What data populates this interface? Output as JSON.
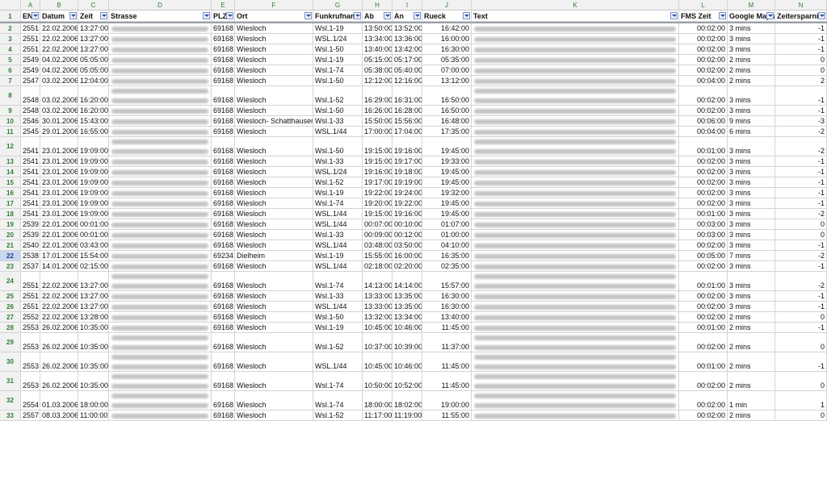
{
  "columns": [
    "A",
    "B",
    "C",
    "D",
    "E",
    "F",
    "G",
    "H",
    "I",
    "J",
    "K",
    "L",
    "M",
    "N"
  ],
  "headers": [
    "ENr",
    "Datum",
    "Zeit",
    "Strasse",
    "PLZ",
    "Ort",
    "Funkrufname",
    "Ab",
    "An",
    "Rueck",
    "Text",
    "FMS Zeit",
    "Google Maps",
    "Zeitersparnis"
  ],
  "header_row_number": "1",
  "rows": [
    {
      "n": "2",
      "v": [
        "2551",
        "22.02.2006",
        "13:27:00",
        "",
        "69168",
        "Wiesloch",
        "Wsl.1-19",
        "13:50:00",
        "13:52:00",
        "16:42:00",
        "",
        "00:02:00",
        "3 mins",
        "-1"
      ]
    },
    {
      "n": "3",
      "v": [
        "2551",
        "22.02.2006",
        "13:27:00",
        "",
        "69168",
        "Wiesloch",
        "WSL.1/24",
        "13:34:00",
        "13:36:00",
        "16:00:00",
        "",
        "00:02:00",
        "3 mins",
        "-1"
      ]
    },
    {
      "n": "4",
      "v": [
        "2551",
        "22.02.2006",
        "13:27:00",
        "",
        "69168",
        "Wiesloch",
        "Wsl.1-50",
        "13:40:00",
        "13:42:00",
        "16:30:00",
        "",
        "00:02:00",
        "3 mins",
        "-1"
      ]
    },
    {
      "n": "5",
      "v": [
        "2549",
        "04.02.2006",
        "05:05:00",
        "",
        "69168",
        "Wiesloch",
        "Wsl.1-19",
        "05:15:00",
        "05:17:00",
        "05:35:00",
        "",
        "00:02:00",
        "2 mins",
        "0"
      ]
    },
    {
      "n": "6",
      "v": [
        "2549",
        "04.02.2006",
        "05:05:00",
        "",
        "69168",
        "Wiesloch",
        "Wsl.1-74",
        "05:38:00",
        "05:40:00",
        "07:00:00",
        "",
        "00:02:00",
        "2 mins",
        "0"
      ]
    },
    {
      "n": "7",
      "v": [
        "2547",
        "03.02.2006",
        "12:04:00",
        "",
        "69168",
        "Wiesloch",
        "Wsl.1-50",
        "12:12:00",
        "12:16:00",
        "13:12:00",
        "",
        "00:04:00",
        "2 mins",
        "2"
      ]
    },
    {
      "n": "8",
      "v": [
        "2548",
        "03.02.2006",
        "16:20:00",
        "",
        "69168",
        "Wiesloch",
        "Wsl.1-52",
        "16:29:00",
        "16:31:00",
        "16:50:00",
        "",
        "00:02:00",
        "3 mins",
        "-1"
      ]
    },
    {
      "n": "9",
      "v": [
        "2548",
        "03.02.2006",
        "16:20:00",
        "",
        "69168",
        "Wiesloch",
        "Wsl.1-50",
        "16:26:00",
        "16:28:00",
        "16:50:00",
        "",
        "00:02:00",
        "3 mins",
        "-1"
      ]
    },
    {
      "n": "10",
      "v": [
        "2546",
        "30.01.2006",
        "15:43:00",
        "",
        "69168",
        "Wiesloch- Schatthausen",
        "Wsl.1-33",
        "15:50:00",
        "15:56:00",
        "16:48:00",
        "",
        "00:06:00",
        "9 mins",
        "-3"
      ]
    },
    {
      "n": "11",
      "v": [
        "2545",
        "29.01.2006",
        "16:55:00",
        "",
        "69168",
        "Wiesloch",
        "WSL.1/44",
        "17:00:00",
        "17:04:00",
        "17:35:00",
        "",
        "00:04:00",
        "6 mins",
        "-2"
      ]
    },
    {
      "n": "12",
      "v": [
        "2541",
        "23.01.2006",
        "19:09:00",
        "",
        "69168",
        "Wiesloch",
        "Wsl.1-50",
        "19:15:00",
        "19:16:00",
        "19:45:00",
        "",
        "00:01:00",
        "3 mins",
        "-2"
      ]
    },
    {
      "n": "13",
      "v": [
        "2541",
        "23.01.2006",
        "19:09:00",
        "",
        "69168",
        "Wiesloch",
        "Wsl.1-33",
        "19:15:00",
        "19:17:00",
        "19:33:00",
        "",
        "00:02:00",
        "3 mins",
        "-1"
      ]
    },
    {
      "n": "14",
      "v": [
        "2541",
        "23.01.2006",
        "19:09:00",
        "",
        "69168",
        "Wiesloch",
        "WSL.1/24",
        "19:16:00",
        "19:18:00",
        "19:45:00",
        "",
        "00:02:00",
        "3 mins",
        "-1"
      ]
    },
    {
      "n": "15",
      "v": [
        "2541",
        "23.01.2006",
        "19:09:00",
        "",
        "69168",
        "Wiesloch",
        "Wsl.1-52",
        "19:17:00",
        "19:19:00",
        "19:45:00",
        "",
        "00:02:00",
        "3 mins",
        "-1"
      ]
    },
    {
      "n": "16",
      "v": [
        "2541",
        "23.01.2006",
        "19:09:00",
        "",
        "69168",
        "Wiesloch",
        "Wsl.1-19",
        "19:22:00",
        "19:24:00",
        "19:32:00",
        "",
        "00:02:00",
        "3 mins",
        "-1"
      ]
    },
    {
      "n": "17",
      "v": [
        "2541",
        "23.01.2006",
        "19:09:00",
        "",
        "69168",
        "Wiesloch",
        "Wsl.1-74",
        "19:20:00",
        "19:22:00",
        "19:45:00",
        "",
        "00:02:00",
        "3 mins",
        "-1"
      ]
    },
    {
      "n": "18",
      "v": [
        "2541",
        "23.01.2006",
        "19:09:00",
        "",
        "69168",
        "Wiesloch",
        "WSL.1/44",
        "19:15:00",
        "19:16:00",
        "19:45:00",
        "",
        "00:01:00",
        "3 mins",
        "-2"
      ]
    },
    {
      "n": "19",
      "v": [
        "2539",
        "22.01.2006",
        "00:01:00",
        "",
        "69168",
        "Wiesloch",
        "WSL.1/44",
        "00:07:00",
        "00:10:00",
        "01:07:00",
        "",
        "00:03:00",
        "3 mins",
        "0"
      ]
    },
    {
      "n": "20",
      "v": [
        "2539",
        "22.01.2006",
        "00:01:00",
        "",
        "69168",
        "Wiesloch",
        "Wsl.1-33",
        "00:09:00",
        "00:12:00",
        "01:00:00",
        "",
        "00:03:00",
        "3 mins",
        "0"
      ]
    },
    {
      "n": "21",
      "v": [
        "2540",
        "22.01.2006",
        "03:43:00",
        "",
        "69168",
        "Wiesloch",
        "WSL.1/44",
        "03:48:00",
        "03:50:00",
        "04:10:00",
        "",
        "00:02:00",
        "3 mins",
        "-1"
      ]
    },
    {
      "n": "22",
      "v": [
        "2538",
        "17.01.2006",
        "15:54:00",
        "",
        "69234",
        "Dielheim",
        "Wsl.1-19",
        "15:55:00",
        "16:00:00",
        "16:35:00",
        "",
        "00:05:00",
        "7 mins",
        "-2"
      ]
    },
    {
      "n": "23",
      "v": [
        "2537",
        "14.01.2006",
        "02:15:00",
        "",
        "69168",
        "Wiesloch",
        "WSL.1/44",
        "02:18:00",
        "02:20:00",
        "02:35:00",
        "",
        "00:02:00",
        "3 mins",
        "-1"
      ]
    },
    {
      "n": "24",
      "v": [
        "2551",
        "22.02.2006",
        "13:27:00",
        "",
        "69168",
        "Wiesloch",
        "Wsl.1-74",
        "14:13:00",
        "14:14:00",
        "15:57:00",
        "",
        "00:01:00",
        "3 mins",
        "-2"
      ]
    },
    {
      "n": "25",
      "v": [
        "2551",
        "22.02.2006",
        "13:27:00",
        "",
        "69168",
        "Wiesloch",
        "Wsl.1-33",
        "13:33:00",
        "13:35:00",
        "16:30:00",
        "",
        "00:02:00",
        "3 mins",
        "-1"
      ]
    },
    {
      "n": "26",
      "v": [
        "2551",
        "22.02.2006",
        "13:27:00",
        "",
        "69168",
        "Wiesloch",
        "WSL.1/44",
        "13:33:00",
        "13:35:00",
        "16:30:00",
        "",
        "00:02:00",
        "3 mins",
        "-1"
      ]
    },
    {
      "n": "27",
      "v": [
        "2552",
        "22.02.2006",
        "13:28:00",
        "",
        "69168",
        "Wiesloch",
        "Wsl.1-50",
        "13:32:00",
        "13:34:00",
        "13:40:00",
        "",
        "00:02:00",
        "2 mins",
        "0"
      ]
    },
    {
      "n": "28",
      "v": [
        "2553",
        "26.02.2006",
        "10:35:00",
        "",
        "69168",
        "Wiesloch",
        "Wsl.1-19",
        "10:45:00",
        "10:46:00",
        "11:45:00",
        "",
        "00:01:00",
        "2 mins",
        "-1"
      ]
    },
    {
      "n": "29",
      "v": [
        "2553",
        "26.02.2006",
        "10:35:00",
        "",
        "69168",
        "Wiesloch",
        "Wsl.1-52",
        "10:37:00",
        "10:39:00",
        "11:37:00",
        "",
        "00:02:00",
        "2 mins",
        "0"
      ]
    },
    {
      "n": "30",
      "v": [
        "2553",
        "26.02.2006",
        "10:35:00",
        "",
        "69168",
        "Wiesloch",
        "WSL.1/44",
        "10:45:00",
        "10:46:00",
        "11:45:00",
        "",
        "00:01:00",
        "2 mins",
        "-1"
      ]
    },
    {
      "n": "31",
      "v": [
        "2553",
        "26.02.2006",
        "10:35:00",
        "",
        "69168",
        "Wiesloch",
        "Wsl.1-74",
        "10:50:00",
        "10:52:00",
        "11:45:00",
        "",
        "00:02:00",
        "2 mins",
        "0"
      ]
    },
    {
      "n": "32",
      "v": [
        "2554",
        "01.03.2006",
        "18:00:00",
        "",
        "69168",
        "Wiesloch",
        "Wsl.1-74",
        "18:00:00",
        "18:02:00",
        "19:00:00",
        "",
        "00:02:00",
        "1 min",
        "1"
      ]
    },
    {
      "n": "33",
      "v": [
        "2557",
        "08.03.2006",
        "11:00:00",
        "",
        "69168",
        "Wiesloch",
        "Wsl.1-52",
        "11:17:00",
        "11:19:00",
        "11:55:00",
        "",
        "00:02:00",
        "2 mins",
        "0"
      ]
    }
  ],
  "selected_row": "22",
  "colors": {
    "accent_green": "#2e7d32",
    "filter_blue": "#2d4c9a",
    "selected_row": "#c8d7ee"
  }
}
